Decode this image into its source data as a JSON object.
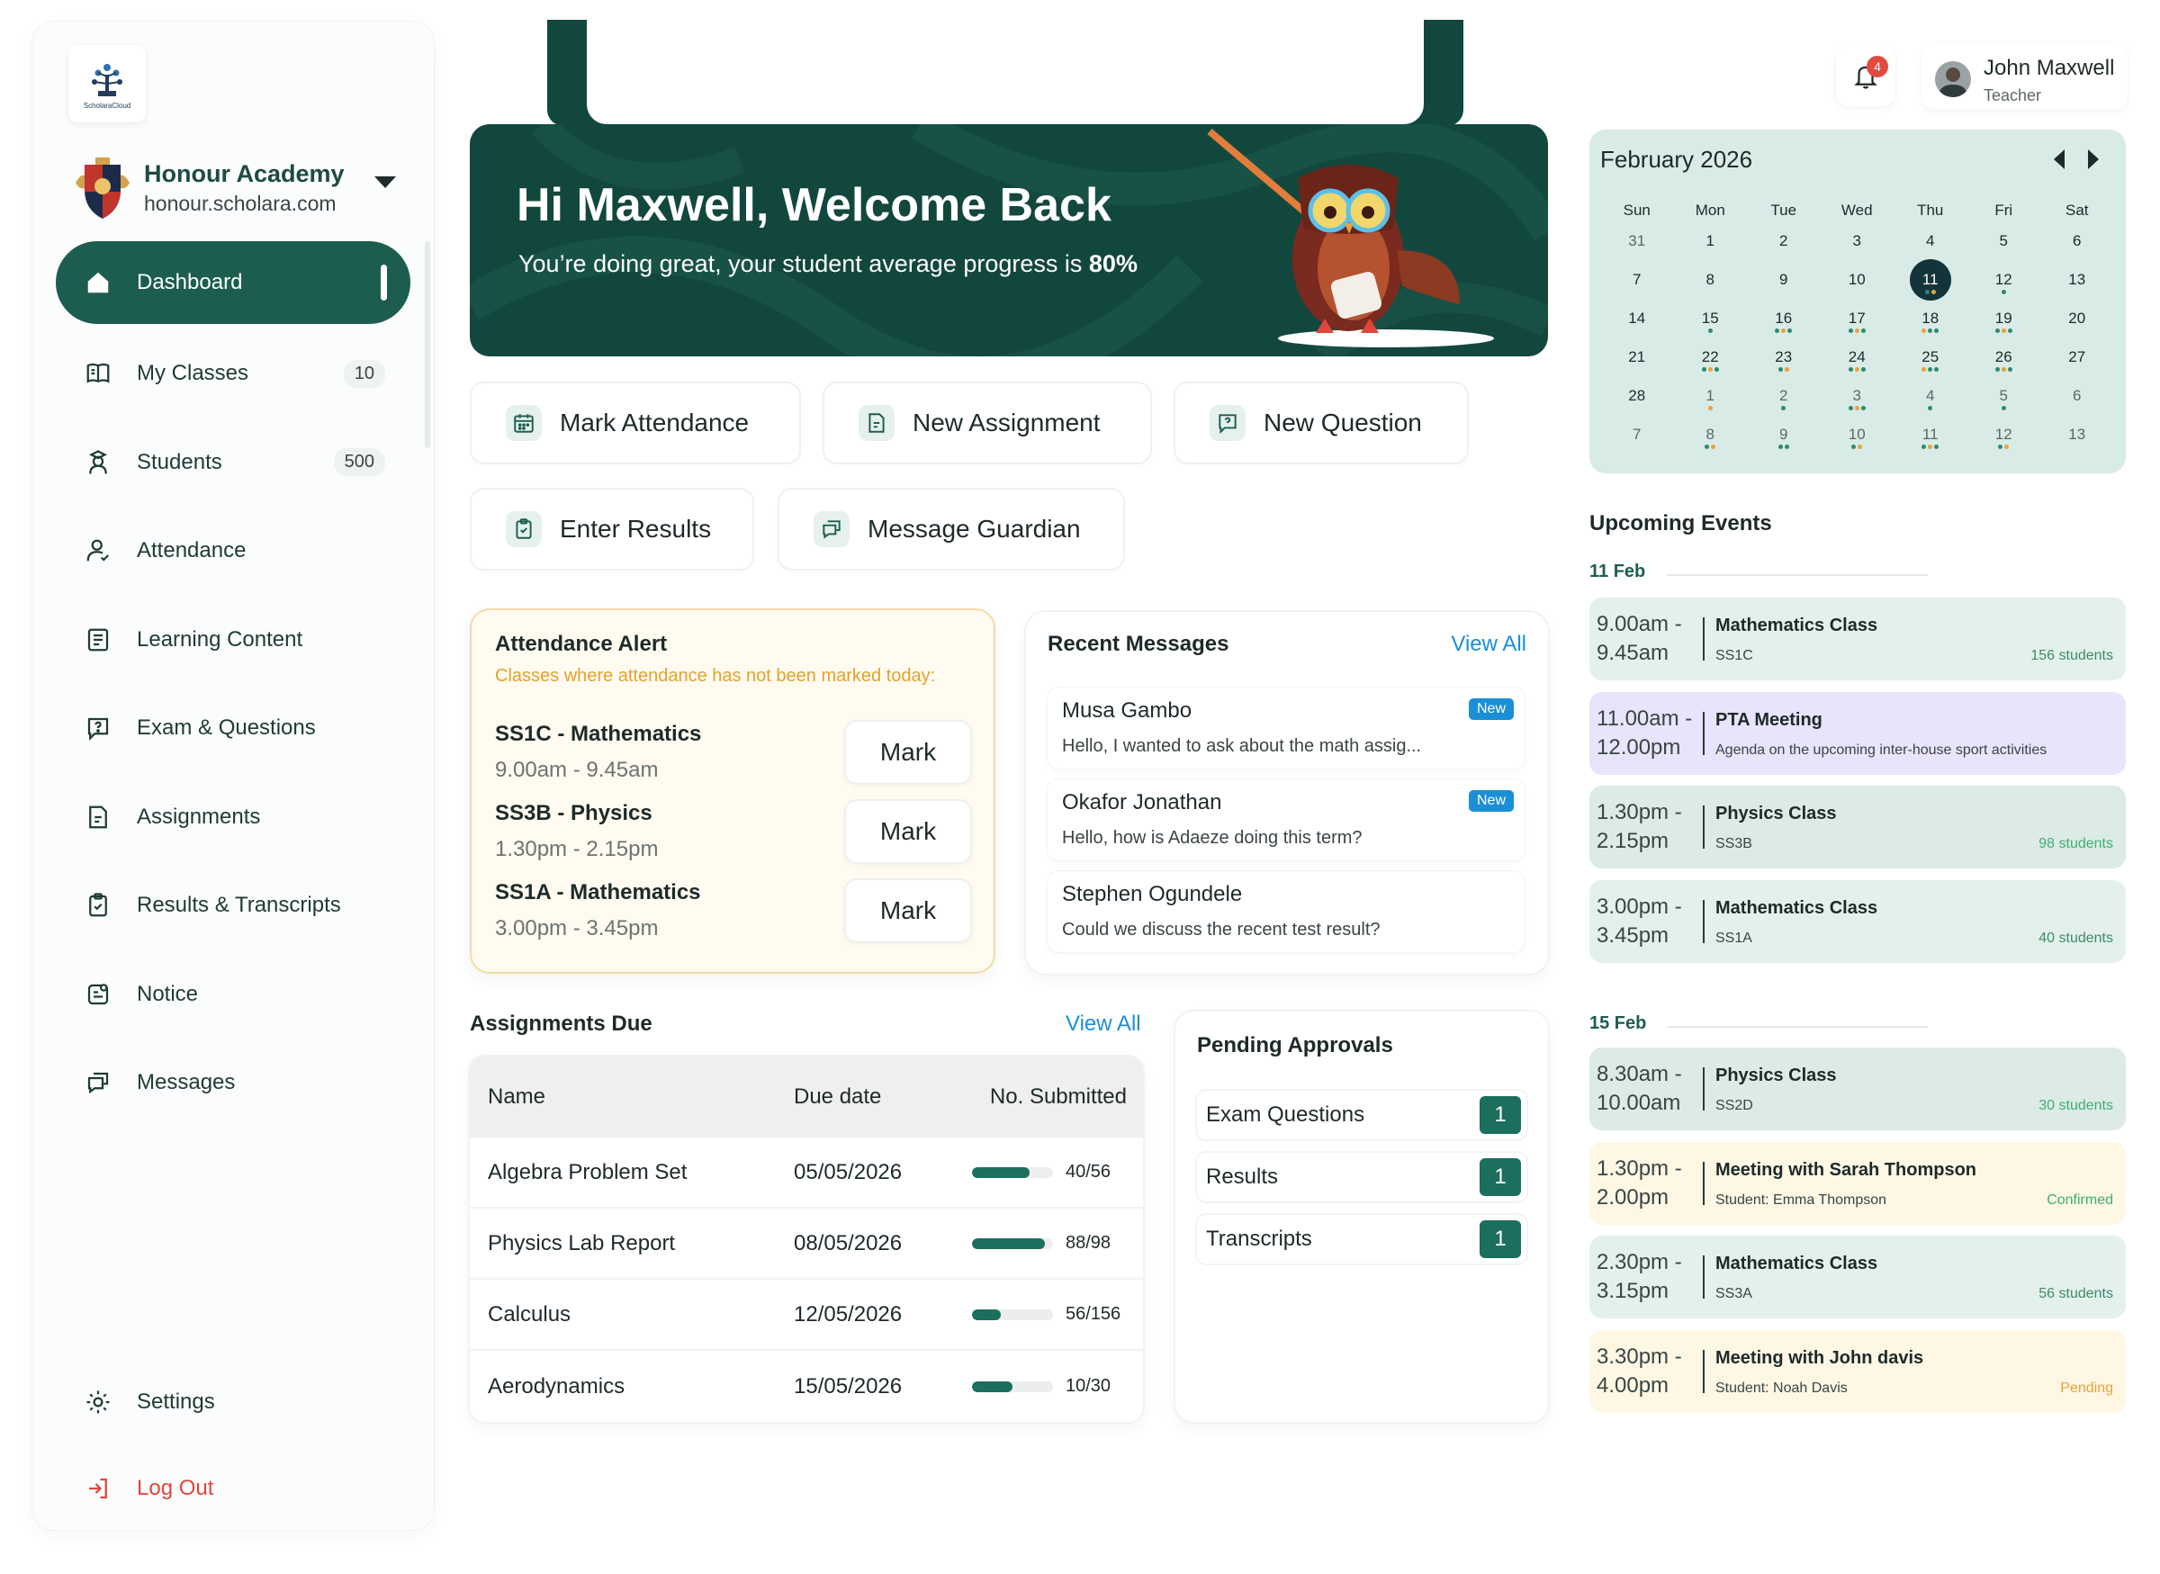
{
  "colors": {
    "brand": "#1c5d4f",
    "hero": "#12473e",
    "accent_link": "#1a8fd6",
    "alert_bg": "#fffbf0",
    "alert_text": "#e4a12b",
    "danger": "#e0463b",
    "today": "#14343b"
  },
  "sidebar": {
    "logo_text": "ScholaraCloud",
    "school_name": "Honour Academy",
    "school_domain": "honour.scholara.com",
    "items": [
      {
        "label": "Dashboard",
        "icon": "home-icon"
      },
      {
        "label": "My Classes",
        "icon": "book-icon",
        "count": "10"
      },
      {
        "label": "Students",
        "icon": "student-icon",
        "count": "500"
      },
      {
        "label": "Attendance",
        "icon": "user-check-icon"
      },
      {
        "label": "Learning Content",
        "icon": "document-icon"
      },
      {
        "label": "Exam & Questions",
        "icon": "question-icon"
      },
      {
        "label": "Assignments",
        "icon": "assignment-icon"
      },
      {
        "label": "Results & Transcripts",
        "icon": "clipboard-icon"
      },
      {
        "label": "Notice",
        "icon": "notice-icon"
      },
      {
        "label": "Messages",
        "icon": "chat-icon"
      }
    ],
    "settings": "Settings",
    "logout": "Log Out"
  },
  "hero": {
    "title": "Hi Maxwell, Welcome Back",
    "subtitle": "You’re doing great, your student average progress is ",
    "progress": "80%"
  },
  "quick_actions": [
    {
      "label": "Mark Attendance",
      "icon": "calendar-icon"
    },
    {
      "label": "New Assignment",
      "icon": "assignment-icon"
    },
    {
      "label": "New Question",
      "icon": "question-icon"
    },
    {
      "label": "Enter Results",
      "icon": "clipboard-check-icon"
    },
    {
      "label": "Message Guardian",
      "icon": "chat-icon"
    }
  ],
  "attendance_alert": {
    "title": "Attendance Alert",
    "subtitle": "Classes where attendance has not been marked today:",
    "rows": [
      {
        "class": "SS1C - Mathematics",
        "time": "9.00am - 9.45am",
        "button": "Mark"
      },
      {
        "class": "SS3B - Physics",
        "time": "1.30pm - 2.15pm",
        "button": "Mark"
      },
      {
        "class": "SS1A - Mathematics",
        "time": "3.00pm - 3.45pm",
        "button": "Mark"
      }
    ]
  },
  "recent_messages": {
    "title": "Recent Messages",
    "view_all": "View All",
    "items": [
      {
        "from": "Musa Gambo",
        "text": "Hello, I wanted to ask about the math assig...",
        "badge": "New"
      },
      {
        "from": "Okafor Jonathan",
        "text": "Hello, how is Adaeze doing this term?",
        "badge": "New"
      },
      {
        "from": "Stephen Ogundele",
        "text": "Could we discuss the recent test result?",
        "badge": ""
      }
    ]
  },
  "assignments": {
    "title": "Assignments Due",
    "view_all": "View All",
    "columns": [
      "Name",
      "Due date",
      "No. Submitted"
    ],
    "rows": [
      {
        "name": "Algebra Problem Set",
        "due": "05/05/2026",
        "submitted": "40/56",
        "progress": 0.71
      },
      {
        "name": "Physics Lab Report",
        "due": "08/05/2026",
        "submitted": "88/98",
        "progress": 0.9
      },
      {
        "name": "Calculus",
        "due": "12/05/2026",
        "submitted": "56/156",
        "progress": 0.36
      },
      {
        "name": "Aerodynamics",
        "due": "15/05/2026",
        "submitted": "10/30",
        "progress": 0.5
      }
    ]
  },
  "pending": {
    "title": "Pending Approvals",
    "items": [
      {
        "label": "Exam Questions",
        "count": "1"
      },
      {
        "label": "Results",
        "count": "1"
      },
      {
        "label": "Transcripts",
        "count": "1"
      }
    ]
  },
  "header": {
    "notification_count": "4",
    "user_name": "John Maxwell",
    "user_role": "Teacher"
  },
  "calendar": {
    "title": "February 2026",
    "weekdays": [
      "Sun",
      "Mon",
      "Tue",
      "Wed",
      "Thu",
      "Fri",
      "Sat"
    ],
    "today": "11",
    "weeks": [
      [
        {
          "d": "31",
          "m": true
        },
        {
          "d": "1"
        },
        {
          "d": "2"
        },
        {
          "d": "3"
        },
        {
          "d": "4"
        },
        {
          "d": "5"
        },
        {
          "d": "6"
        }
      ],
      [
        {
          "d": "7"
        },
        {
          "d": "8"
        },
        {
          "d": "9"
        },
        {
          "d": "10"
        },
        {
          "d": "11",
          "t": true,
          "dots": [
            "#2d8a6e",
            "#e9a23b"
          ]
        },
        {
          "d": "12",
          "dots": [
            "#2d8a6e"
          ]
        },
        {
          "d": "13"
        }
      ],
      [
        {
          "d": "14"
        },
        {
          "d": "15",
          "dots": [
            "#2d8a6e"
          ]
        },
        {
          "d": "16",
          "dots": [
            "#2d8a6e",
            "#e9a23b",
            "#2d8a6e"
          ]
        },
        {
          "d": "17",
          "dots": [
            "#2d8a6e",
            "#e9a23b",
            "#2d8a6e"
          ]
        },
        {
          "d": "18",
          "dots": [
            "#e9a23b",
            "#2d8a6e",
            "#2d8a6e"
          ]
        },
        {
          "d": "19",
          "dots": [
            "#2d8a6e",
            "#e9a23b",
            "#2d8a6e"
          ]
        },
        {
          "d": "20"
        }
      ],
      [
        {
          "d": "21"
        },
        {
          "d": "22",
          "dots": [
            "#2d8a6e",
            "#e9a23b",
            "#2d8a6e"
          ]
        },
        {
          "d": "23",
          "dots": [
            "#2d8a6e",
            "#e9a23b"
          ]
        },
        {
          "d": "24",
          "dots": [
            "#2d8a6e",
            "#e9a23b",
            "#2d8a6e"
          ]
        },
        {
          "d": "25",
          "dots": [
            "#e9a23b",
            "#2d8a6e",
            "#2d8a6e"
          ]
        },
        {
          "d": "26",
          "dots": [
            "#2d8a6e",
            "#e9a23b",
            "#2d8a6e"
          ]
        },
        {
          "d": "27"
        }
      ],
      [
        {
          "d": "28"
        },
        {
          "d": "1",
          "m": true,
          "dots": [
            "#e9a23b"
          ]
        },
        {
          "d": "2",
          "m": true,
          "dots": [
            "#2d8a6e"
          ]
        },
        {
          "d": "3",
          "m": true,
          "dots": [
            "#2d8a6e",
            "#e9a23b",
            "#2d8a6e"
          ]
        },
        {
          "d": "4",
          "m": true,
          "dots": [
            "#2d8a6e"
          ]
        },
        {
          "d": "5",
          "m": true,
          "dots": [
            "#2d8a6e"
          ]
        },
        {
          "d": "6",
          "m": true
        }
      ],
      [
        {
          "d": "7",
          "m": true
        },
        {
          "d": "8",
          "m": true,
          "dots": [
            "#2d8a6e",
            "#e9a23b"
          ]
        },
        {
          "d": "9",
          "m": true,
          "dots": [
            "#2d8a6e",
            "#2d8a6e"
          ]
        },
        {
          "d": "10",
          "m": true,
          "dots": [
            "#2d8a6e",
            "#e9a23b"
          ]
        },
        {
          "d": "11",
          "m": true,
          "dots": [
            "#2d8a6e",
            "#e9a23b",
            "#2d8a6e"
          ]
        },
        {
          "d": "12",
          "m": true,
          "dots": [
            "#2d8a6e",
            "#e9a23b"
          ]
        },
        {
          "d": "13",
          "m": true
        }
      ]
    ]
  },
  "events": {
    "title": "Upcoming Events",
    "groups": [
      {
        "date": "11 Feb",
        "items": [
          {
            "start": "9.00am -",
            "end": "9.45am",
            "name": "Mathematics Class",
            "sub": "SS1C",
            "tag": "156 students",
            "style": "green",
            "tag_color": "#3f8a6e"
          },
          {
            "start": "11.00am -",
            "end": "12.00pm",
            "name": "PTA Meeting",
            "sub": "Agenda on the upcoming inter-house sport activities",
            "tag": "",
            "style": "purple",
            "tag_color": "#3f8a6e"
          },
          {
            "start": "1.30pm -",
            "end": "2.15pm",
            "name": "Physics Class",
            "sub": "SS3B",
            "tag": "98 students",
            "style": "teal",
            "tag_color": "#3fae76"
          },
          {
            "start": "3.00pm -",
            "end": "3.45pm",
            "name": "Mathematics Class",
            "sub": "SS1A",
            "tag": "40 students",
            "style": "green",
            "tag_color": "#3f8a6e"
          }
        ]
      },
      {
        "date": "15 Feb",
        "items": [
          {
            "start": "8.30am -",
            "end": "10.00am",
            "name": "Physics Class",
            "sub": "SS2D",
            "tag": "30 students",
            "style": "teal",
            "tag_color": "#3fae76"
          },
          {
            "start": "1.30pm -",
            "end": "2.00pm",
            "name": "Meeting with Sarah Thompson",
            "sub": "Student: Emma Thompson",
            "tag": "Confirmed",
            "style": "yellow",
            "tag_color": "#3fae76"
          },
          {
            "start": "2.30pm -",
            "end": "3.15pm",
            "name": "Mathematics Class",
            "sub": "SS3A",
            "tag": "56 students",
            "style": "green",
            "tag_color": "#3f8a6e"
          },
          {
            "start": "3.30pm -",
            "end": "4.00pm",
            "name": "Meeting with John davis",
            "sub": "Student: Noah Davis",
            "tag": "Pending",
            "style": "yellow",
            "tag_color": "#e9a23b"
          }
        ]
      }
    ]
  }
}
